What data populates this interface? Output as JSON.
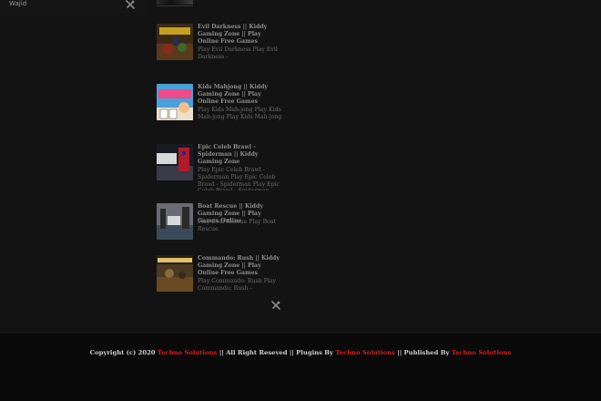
{
  "sidebar": {
    "author": "Wajid",
    "icon": "wrench-screwdriver-icon"
  },
  "posts": [
    {
      "title": "Evil Darkness || Kiddy Gaming Zone || Play Online Free Games",
      "excerpt": "Play Evil Darkness Play Evil Darkness -"
    },
    {
      "title": "Kids Mahjong || Kiddy Gaming Zone || Play Online Free Games",
      "excerpt": "Play Kids Mah-jong  Play Kids Mah-jong   Play Kids Mah-jong"
    },
    {
      "title": "Epic Celeb Brawl - Spiderman || Kiddy Gaming Zone",
      "excerpt": "Play Epic Celeb Brawl - Spiderman Play Epic Celeb Brawl - Spiderman Play Epic Celeb Brawl - Spiderman"
    },
    {
      "title": "Boat Rescue || Kiddy Gaming Zone || Play Games Online",
      "excerpt": "Play  Boat Rescue Play  Boat Rescue"
    },
    {
      "title": "Commando: Rush || Kiddy Gaming Zone || Play Online Free Games",
      "excerpt": "Play Commando: Rush Play Commando: Rush -"
    }
  ],
  "footer": {
    "copyright_prefix": "Copyright (c) 2020",
    "brand1": "Techno Solutions",
    "middle": "|| All Right Reseved || Plugins By",
    "brand2": "Techno Solutions",
    "published": "|| Published By",
    "brand3": "Techno Solutions"
  },
  "colors": {
    "background": "#131313",
    "footer_bg": "#0a0a0a",
    "brand_red": "#d21f1f"
  }
}
